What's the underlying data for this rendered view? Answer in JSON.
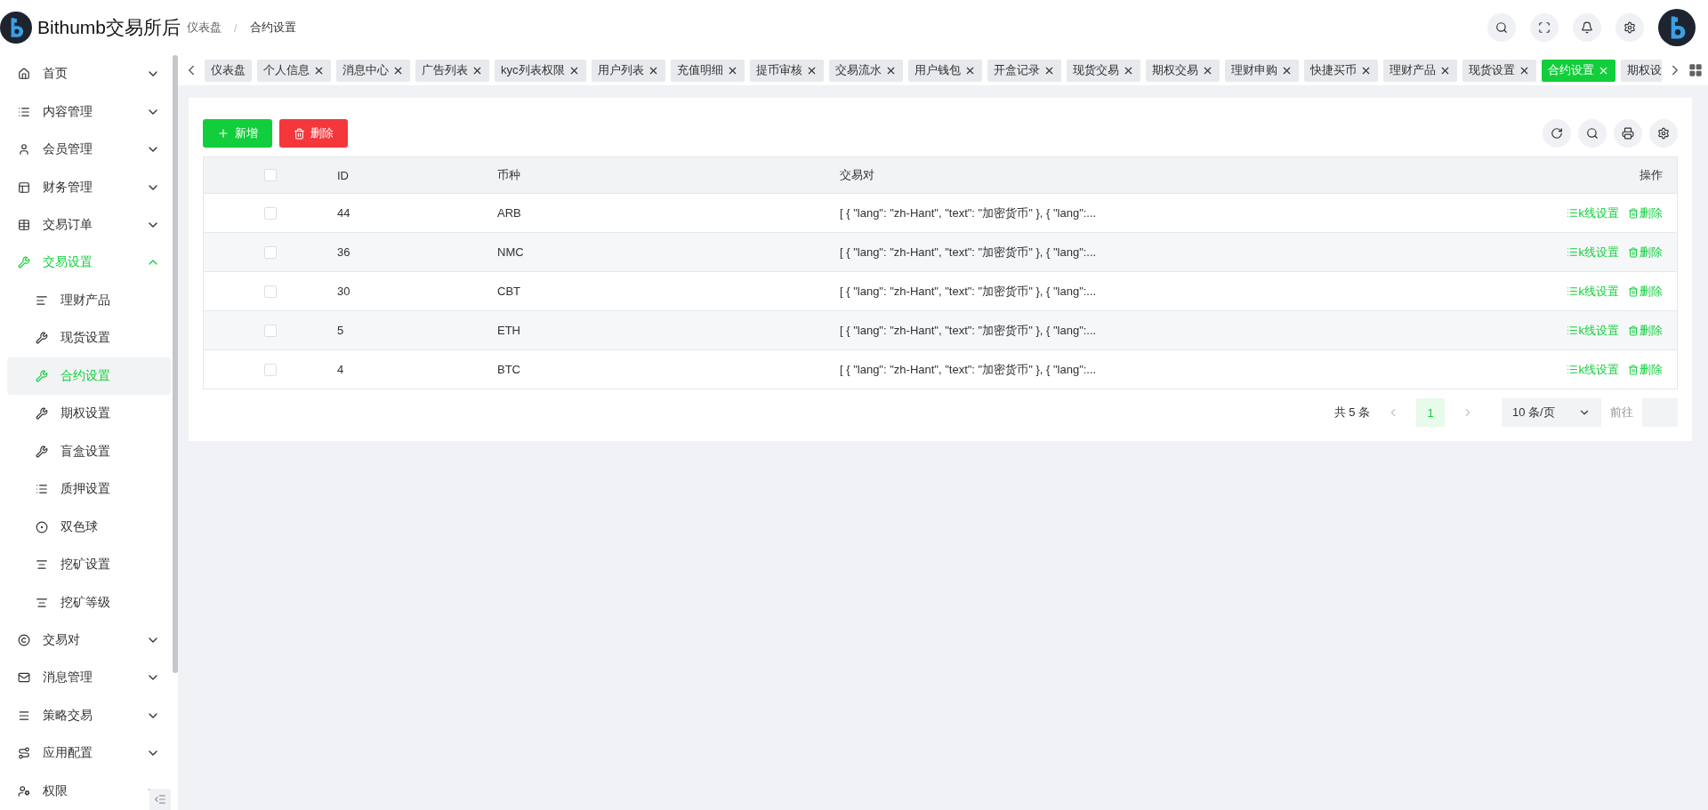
{
  "header": {
    "title": "Bithumb交易所后",
    "separator": "/",
    "breadcrumb": [
      {
        "label": "仪表盘"
      },
      {
        "label": "合约设置"
      }
    ]
  },
  "sidebar": {
    "items": [
      {
        "label": "首页",
        "expanded": false
      },
      {
        "label": "内容管理",
        "expanded": false
      },
      {
        "label": "会员管理",
        "expanded": false
      },
      {
        "label": "财务管理",
        "expanded": false
      },
      {
        "label": "交易订单",
        "expanded": false
      },
      {
        "label": "交易设置",
        "expanded": true,
        "children": [
          {
            "label": "理财产品",
            "selected": false
          },
          {
            "label": "现货设置",
            "selected": false
          },
          {
            "label": "合约设置",
            "selected": true
          },
          {
            "label": "期权设置",
            "selected": false
          },
          {
            "label": "盲盒设置",
            "selected": false
          },
          {
            "label": "质押设置",
            "selected": false
          },
          {
            "label": "双色球",
            "selected": false
          },
          {
            "label": "挖矿设置",
            "selected": false
          },
          {
            "label": "挖矿等级",
            "selected": false
          }
        ]
      },
      {
        "label": "交易对",
        "expanded": false
      },
      {
        "label": "消息管理",
        "expanded": false
      },
      {
        "label": "策略交易",
        "expanded": false
      },
      {
        "label": "应用配置",
        "expanded": false
      },
      {
        "label": "权限",
        "expanded": false
      }
    ]
  },
  "tabs": [
    {
      "label": "仪表盘",
      "selected": false,
      "closable": false
    },
    {
      "label": "个人信息",
      "selected": false,
      "closable": true
    },
    {
      "label": "消息中心",
      "selected": false,
      "closable": true
    },
    {
      "label": "广告列表",
      "selected": false,
      "closable": true
    },
    {
      "label": "kyc列表权限",
      "selected": false,
      "closable": true
    },
    {
      "label": "用户列表",
      "selected": false,
      "closable": true
    },
    {
      "label": "充值明细",
      "selected": false,
      "closable": true
    },
    {
      "label": "提币审核",
      "selected": false,
      "closable": true
    },
    {
      "label": "交易流水",
      "selected": false,
      "closable": true
    },
    {
      "label": "用户钱包",
      "selected": false,
      "closable": true
    },
    {
      "label": "开盒记录",
      "selected": false,
      "closable": true
    },
    {
      "label": "现货交易",
      "selected": false,
      "closable": true
    },
    {
      "label": "期权交易",
      "selected": false,
      "closable": true
    },
    {
      "label": "理财申购",
      "selected": false,
      "closable": true
    },
    {
      "label": "快捷买币",
      "selected": false,
      "closable": true
    },
    {
      "label": "理财产品",
      "selected": false,
      "closable": true
    },
    {
      "label": "现货设置",
      "selected": false,
      "closable": true
    },
    {
      "label": "合约设置",
      "selected": true,
      "closable": true
    },
    {
      "label": "期权设",
      "selected": false,
      "closable": false
    }
  ],
  "toolbar": {
    "add": "新增",
    "delete": "删除"
  },
  "table": {
    "header_checked": false,
    "columns": [
      "ID",
      "币种",
      "交易对",
      "操作"
    ],
    "rows": [
      {
        "checked": false,
        "id": "44",
        "coin": "ARB",
        "pair": "[ { \"lang\": \"zh-Hant\", \"text\": \"加密货币\" }, { \"lang\":...",
        "actions": [
          "k线设置",
          "删除"
        ]
      },
      {
        "checked": false,
        "id": "36",
        "coin": "NMC",
        "pair": "[ { \"lang\": \"zh-Hant\", \"text\": \"加密货币\" }, { \"lang\":...",
        "actions": [
          "k线设置",
          "删除"
        ]
      },
      {
        "checked": false,
        "id": "30",
        "coin": "CBT",
        "pair": "[ { \"lang\": \"zh-Hant\", \"text\": \"加密货币\" }, { \"lang\":...",
        "actions": [
          "k线设置",
          "删除"
        ]
      },
      {
        "checked": false,
        "id": "5",
        "coin": "ETH",
        "pair": "[ { \"lang\": \"zh-Hant\", \"text\": \"加密货币\" }, { \"lang\":...",
        "actions": [
          "k线设置",
          "删除"
        ]
      },
      {
        "checked": false,
        "id": "4",
        "coin": "BTC",
        "pair": "[ { \"lang\": \"zh-Hant\", \"text\": \"加密货币\" }, { \"lang\":...",
        "actions": [
          "k线设置",
          "删除"
        ]
      }
    ]
  },
  "pagination": {
    "total": "共 5 条",
    "pages": [
      {
        "label": "1",
        "selected": true
      }
    ],
    "page_size": "10 条/页",
    "goto": "前往"
  }
}
